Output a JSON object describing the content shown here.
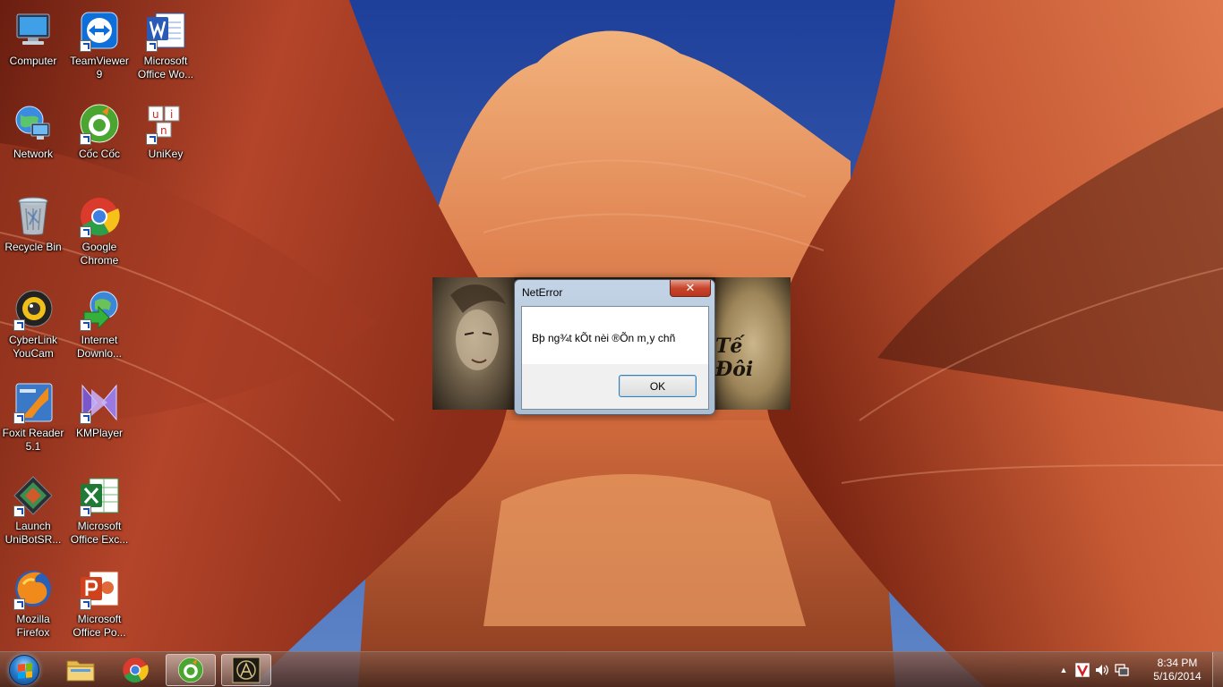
{
  "desktop": {
    "icons": [
      {
        "label": "Computer",
        "icon": "computer-icon"
      },
      {
        "label": "TeamViewer\n9",
        "icon": "teamviewer-icon"
      },
      {
        "label": "Microsoft\nOffice Wo...",
        "icon": "word-icon"
      },
      {
        "label": "Network",
        "icon": "network-icon"
      },
      {
        "label": "Cốc Cốc",
        "icon": "coccoc-icon"
      },
      {
        "label": "UniKey",
        "icon": "unikey-icon"
      },
      {
        "label": "Recycle Bin",
        "icon": "recycle-bin-icon"
      },
      {
        "label": "Google\nChrome",
        "icon": "chrome-icon"
      },
      {
        "label": "CyberLink\nYouCam",
        "icon": "youcam-icon"
      },
      {
        "label": "Internet\nDownlo...",
        "icon": "idm-icon"
      },
      {
        "label": "Foxit Reader\n5.1",
        "icon": "foxit-icon"
      },
      {
        "label": "KMPlayer",
        "icon": "kmplayer-icon"
      },
      {
        "label": "Launch\nUniBotSR...",
        "icon": "unibot-icon"
      },
      {
        "label": "Microsoft\nOffice Exc...",
        "icon": "excel-icon"
      },
      {
        "label": "Mozilla\nFirefox",
        "icon": "firefox-icon"
      },
      {
        "label": "Microsoft\nOffice Po...",
        "icon": "powerpoint-icon"
      }
    ]
  },
  "dialog": {
    "title": "NetError",
    "close_label": "✕",
    "message": "Bþ ng¾t kÕt nèi ®Õn m¸y chñ",
    "ok_label": "OK"
  },
  "splash": {
    "logo_text": "Tế Đôi"
  },
  "taskbar": {
    "pinned": [
      {
        "name": "explorer",
        "icon": "folder-icon"
      },
      {
        "name": "chrome",
        "icon": "chrome-icon"
      },
      {
        "name": "coccoc",
        "icon": "coccoc-icon",
        "active": true
      },
      {
        "name": "game",
        "icon": "game-icon",
        "active": true
      }
    ],
    "tray": {
      "show_hidden": "▲",
      "clock_time": "8:34 PM",
      "clock_date": "5/16/2014"
    }
  },
  "colors": {
    "dialog_frame": "#a9bdd3",
    "close_red": "#c8452c",
    "ok_border": "#3c7fb1"
  }
}
